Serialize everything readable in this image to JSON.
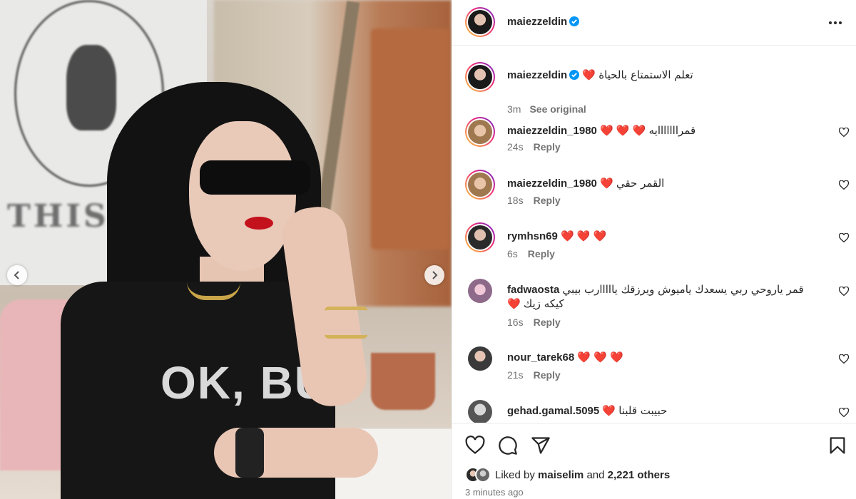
{
  "post": {
    "author": "maiezzeldin",
    "verified": true,
    "more_icon": "more-horizontal-icon"
  },
  "caption": {
    "username": "maiezzeldin",
    "text": "تعلم الاستمتاع بالحياة",
    "emoji": "❤️",
    "time": "3m",
    "see_original": "See original"
  },
  "comments": [
    {
      "username": "maiezzeldin_1980",
      "emoji": "❤️ ❤️ ❤️",
      "text": "قمرااااااايه",
      "time": "24s",
      "reply": "Reply"
    },
    {
      "username": "maiezzeldin_1980",
      "emoji": "❤️",
      "text": "القمر حقي",
      "time": "18s",
      "reply": "Reply"
    },
    {
      "username": "rymhsn69",
      "emoji": "❤️ ❤️ ❤️",
      "text": "",
      "time": "6s",
      "reply": "Reply"
    },
    {
      "username": "fadwaosta",
      "emoji": "",
      "text": "قمر ياروحي ربي يسعدك ياميوش ويرزقك يااااارب بيبي",
      "text2": "كيكه زيك",
      "emoji2": "❤️",
      "time": "16s",
      "reply": "Reply"
    },
    {
      "username": "nour_tarek68",
      "emoji": "❤️ ❤️ ❤️",
      "text": "",
      "time": "21s",
      "reply": "Reply"
    },
    {
      "username": "gehad.gamal.5095",
      "emoji": "❤️",
      "text": "حبيبت قلبنا",
      "time": "",
      "reply": ""
    }
  ],
  "actions": {
    "like_icon": "heart-icon",
    "comment_icon": "comment-icon",
    "share_icon": "share-icon",
    "save_icon": "bookmark-icon"
  },
  "likes": {
    "prefix": "Liked by",
    "user": "maiselim",
    "and": "and",
    "others": "2,221 others"
  },
  "timestamp": "3 minutes ago",
  "photo": {
    "shirt_text": "OK, BUT",
    "sign_text": "THIS W",
    "prev_icon": "chevron-left-icon",
    "next_icon": "chevron-right-icon"
  }
}
